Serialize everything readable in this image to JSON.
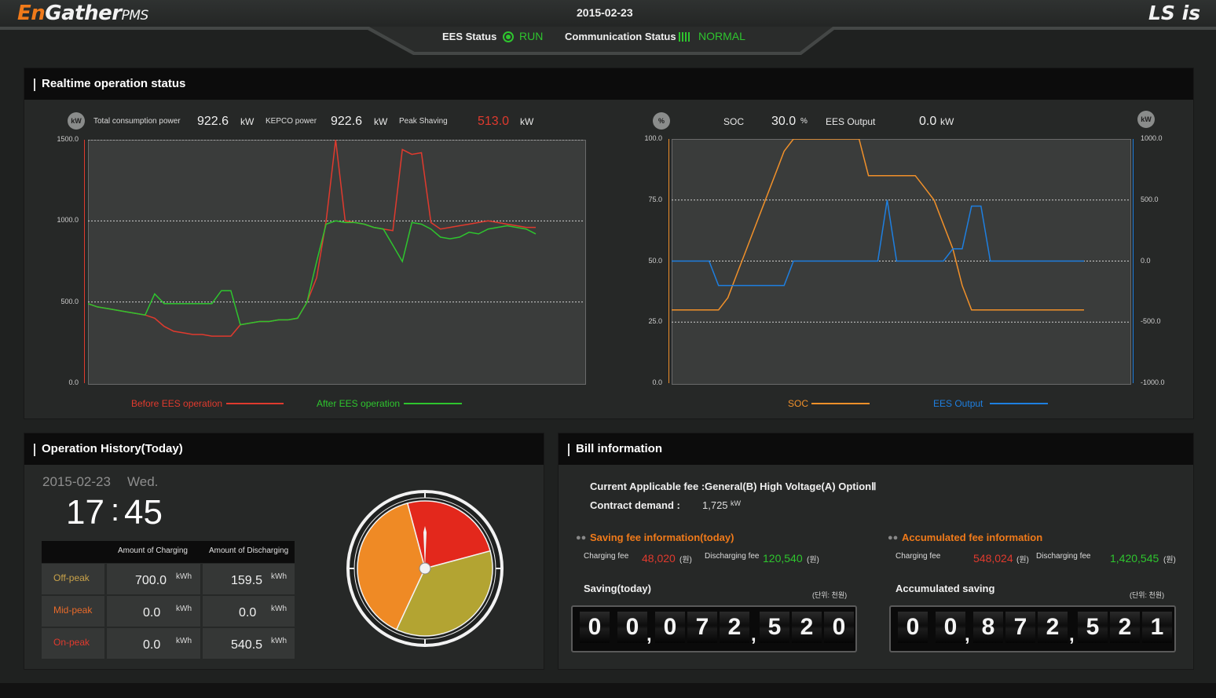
{
  "header": {
    "logo_en": "En",
    "logo_gather": "Gather",
    "logo_pms": "PMS",
    "brand": "LS is",
    "date": "2015-02-23",
    "ees_status_label": "EES Status",
    "ees_status_value": "RUN",
    "comm_status_label": "Communication Status",
    "comm_status_value": "NORMAL",
    "accent_green": "#2ec52e",
    "accent_orange": "#f07a1a"
  },
  "realtime": {
    "title": "Realtime operation status",
    "power_badge": "kW",
    "total_label": "Total consumption power",
    "total_value": "922.6",
    "total_unit": "kW",
    "kepco_label": "KEPCO power",
    "kepco_value": "922.6",
    "kepco_unit": "kW",
    "peak_label": "Peak Shaving",
    "peak_value": "513.0",
    "peak_unit": "kW",
    "soc_badge": "%",
    "soc_label": "SOC",
    "soc_value": "30.0",
    "soc_unit": "%",
    "ees_out_label": "EES Output",
    "ees_out_value": "0.0",
    "ees_out_unit": "kW",
    "kw_badge_right": "kW"
  },
  "chart_data": [
    {
      "type": "line",
      "ylim": [
        0,
        1500
      ],
      "y_ticks": [
        "1500.0",
        "1000.0",
        "500.0",
        "0.0"
      ],
      "legend": "bottom",
      "grid": true,
      "series": [
        {
          "name": "Before EES operation",
          "color": "#e03a2e",
          "values": [
            490,
            470,
            460,
            450,
            440,
            430,
            420,
            400,
            350,
            320,
            310,
            300,
            300,
            290,
            290,
            290,
            360,
            370,
            380,
            380,
            390,
            390,
            400,
            500,
            650,
            1000,
            1500,
            1000,
            990,
            980,
            960,
            950,
            940,
            1440,
            1410,
            1420,
            990,
            950,
            960,
            970,
            980,
            990,
            1000,
            990,
            980,
            970,
            960,
            960
          ]
        },
        {
          "name": "After EES operation",
          "color": "#2ec52e",
          "values": [
            490,
            470,
            460,
            450,
            440,
            430,
            420,
            550,
            490,
            490,
            490,
            490,
            490,
            490,
            570,
            570,
            360,
            370,
            380,
            380,
            390,
            390,
            400,
            500,
            750,
            980,
            1000,
            990,
            990,
            980,
            960,
            950,
            850,
            750,
            990,
            980,
            950,
            900,
            890,
            900,
            930,
            920,
            950,
            960,
            970,
            960,
            950,
            920
          ]
        }
      ]
    },
    {
      "type": "line",
      "ylim": [
        0,
        100
      ],
      "y_ticks": [
        "100.0",
        "75.0",
        "50.0",
        "25.0",
        "0.0"
      ],
      "y2lim": [
        -1000,
        1000
      ],
      "y2_ticks": [
        "1000.0",
        "500.0",
        "0.0",
        "-500.0",
        "-1000.0"
      ],
      "legend": "bottom",
      "grid": true,
      "series": [
        {
          "name": "SOC",
          "color": "#f0902a",
          "axis": "left",
          "values": [
            30,
            30,
            30,
            30,
            30,
            30,
            35,
            45,
            55,
            65,
            75,
            85,
            95,
            100,
            100,
            100,
            100,
            100,
            100,
            100,
            100,
            85,
            85,
            85,
            85,
            85,
            85,
            80,
            75,
            65,
            55,
            40,
            30,
            30,
            30,
            30,
            30,
            30,
            30,
            30,
            30,
            30,
            30,
            30,
            30
          ]
        },
        {
          "name": "EES Output",
          "color": "#1e7fe0",
          "axis": "right",
          "values": [
            0,
            0,
            0,
            0,
            0,
            -200,
            -200,
            -200,
            -200,
            -200,
            -200,
            -200,
            -200,
            0,
            0,
            0,
            0,
            0,
            0,
            0,
            0,
            0,
            0,
            500,
            0,
            0,
            0,
            0,
            0,
            0,
            100,
            100,
            450,
            450,
            0,
            0,
            0,
            0,
            0,
            0,
            0,
            0,
            0,
            0,
            0
          ]
        }
      ]
    }
  ],
  "history": {
    "title": "Operation History(Today)",
    "date": "2015-02-23",
    "weekday": "Wed.",
    "hour": "17",
    "colon": ":",
    "minute": "45",
    "col_charging": "Amount of Charging",
    "col_discharging": "Amount of Discharging",
    "rows": [
      {
        "label": "Off-peak",
        "charge": "700.0",
        "discharge": "159.5",
        "unit": "kWh",
        "color": "#c8a24a"
      },
      {
        "label": "Mid-peak",
        "charge": "0.0",
        "discharge": "0.0",
        "unit": "kWh",
        "color": "#e86a2a"
      },
      {
        "label": "On-peak",
        "charge": "0.0",
        "discharge": "540.5",
        "unit": "kWh",
        "color": "#e03a2e"
      }
    ],
    "clock_sectors": [
      {
        "name": "On-peak",
        "color": "#e3281c"
      },
      {
        "name": "Off-peak",
        "color": "#b3a432"
      },
      {
        "name": "Mid-peak",
        "color": "#ef8a25"
      }
    ]
  },
  "bill": {
    "title": "Bill information",
    "fee_label": "Current Applicable fee :",
    "fee_value": "General(B) High Voltage(A) OptionⅡ",
    "contract_label": "Contract demand :",
    "contract_value": "1,725",
    "contract_unit": "kW",
    "saving_title": "Saving fee information(today)",
    "saving_charge_label": "Charging fee",
    "saving_charge_value": "48,020",
    "saving_discharge_label": "Discharging fee",
    "saving_discharge_value": "120,540",
    "won": "(원)",
    "accum_title": "Accumulated fee information",
    "accum_charge_label": "Charging fee",
    "accum_charge_value": "548,024",
    "accum_discharge_label": "Discharging fee",
    "accum_discharge_value": "1,420,545",
    "saving_today_label": "Saving(today)",
    "accum_saving_label": "Accumulated saving",
    "unit_note": "(단위: 천원)",
    "saving_digits": [
      "0",
      "0",
      "0",
      "7",
      "2",
      "5",
      "2",
      "0"
    ],
    "accum_digits": [
      "0",
      "0",
      "8",
      "7",
      "2",
      "5",
      "2",
      "1"
    ]
  }
}
